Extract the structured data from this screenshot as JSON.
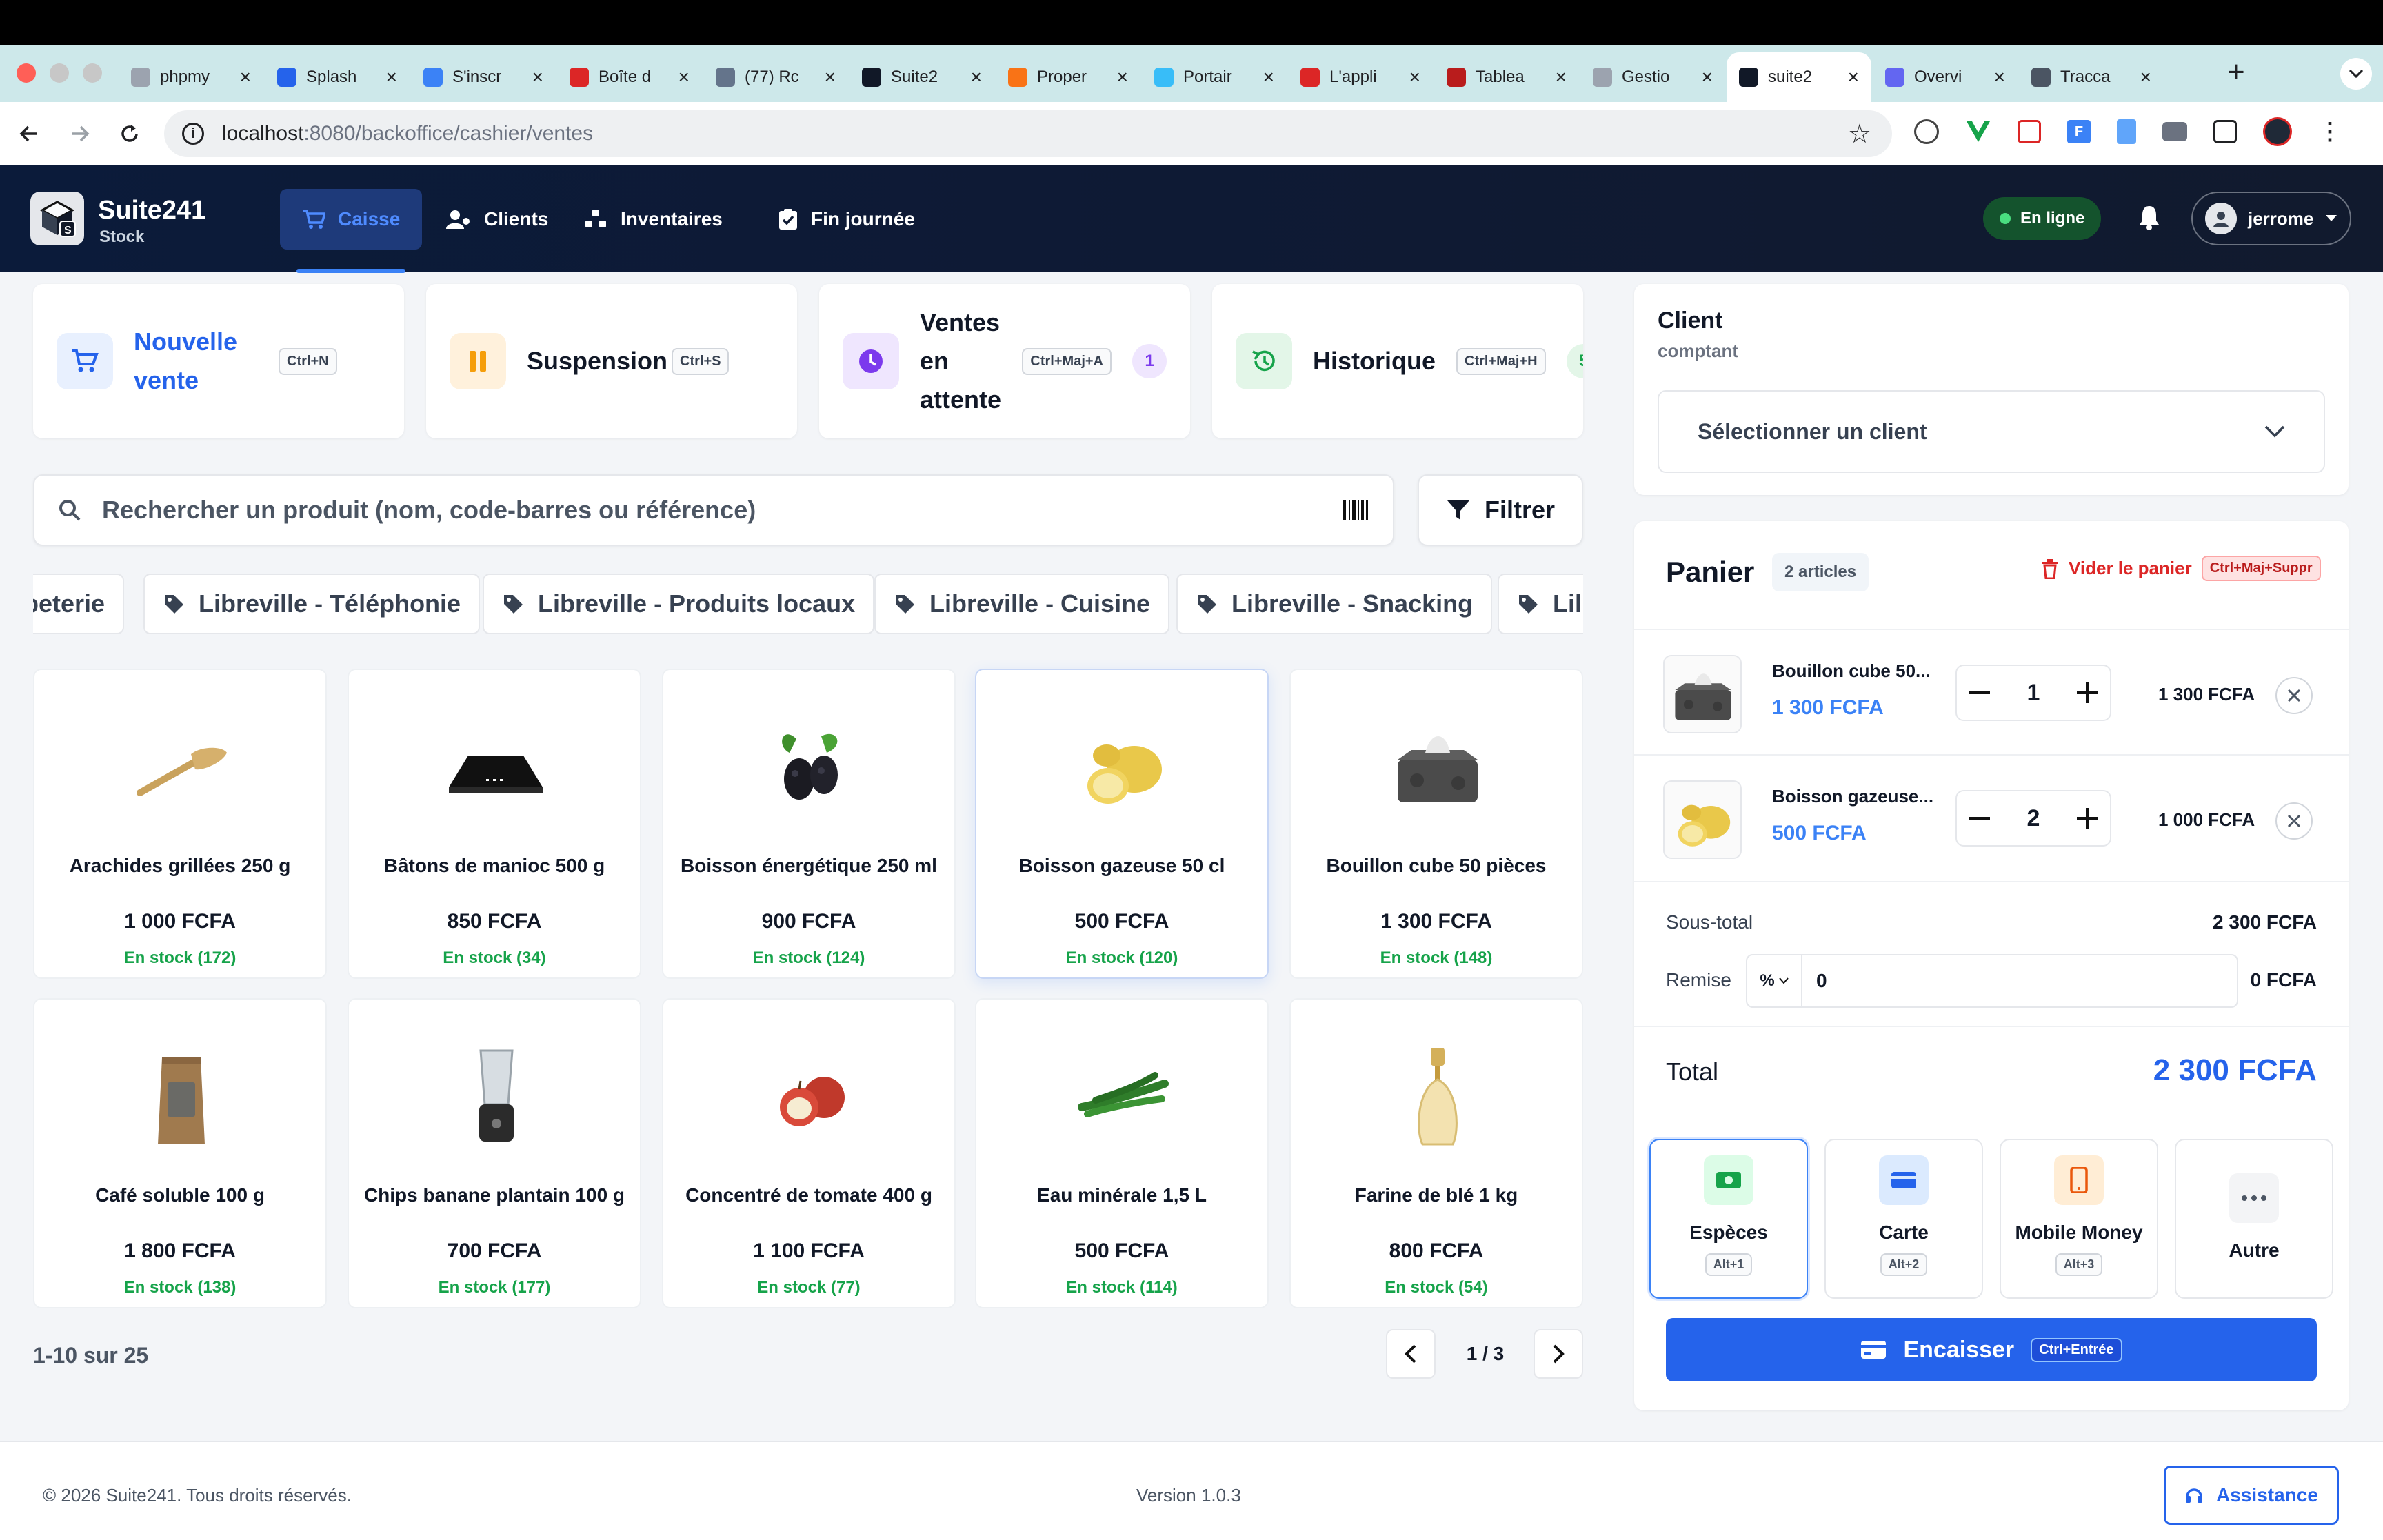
{
  "browser": {
    "tabs": [
      {
        "label": "phpmy",
        "icon": "globe-icon",
        "color": "#9ca3af"
      },
      {
        "label": "Splash",
        "icon": "splash-icon",
        "color": "#2563eb"
      },
      {
        "label": "S'inscr",
        "icon": "apple-icon",
        "color": "#3b82f6"
      },
      {
        "label": "Boîte d",
        "icon": "mail-icon",
        "color": "#dc2626"
      },
      {
        "label": "(77) Rc",
        "icon": "reddit-icon",
        "color": "#64748b"
      },
      {
        "label": "Suite2",
        "icon": "terminal-icon",
        "color": "#111827"
      },
      {
        "label": "Proper",
        "icon": "microsoft-icon",
        "color": "#f97316"
      },
      {
        "label": "Portair",
        "icon": "portainer-icon",
        "color": "#38bdf8"
      },
      {
        "label": "L'appli",
        "icon": "laravel-icon",
        "color": "#dc2626"
      },
      {
        "label": "Tablea",
        "icon": "gmail-icon",
        "color": "#b91c1c"
      },
      {
        "label": "Gestio",
        "icon": "globe-icon",
        "color": "#9ca3af"
      },
      {
        "label": "suite2",
        "icon": "app-icon",
        "color": "#111827"
      },
      {
        "label": "Overvi",
        "icon": "overview-icon",
        "color": "#6366f1"
      },
      {
        "label": "Tracca",
        "icon": "traccar-icon",
        "color": "#4b5563"
      }
    ],
    "url_host": "localhost",
    "url_path": ":8080/backoffice/cashier/ventes"
  },
  "app": {
    "brand": "Suite241",
    "brand_sub": "Stock",
    "nav": [
      {
        "label": "Caisse",
        "icon": "cart-icon"
      },
      {
        "label": "Clients",
        "icon": "users-icon"
      },
      {
        "label": "Inventaires",
        "icon": "inventory-icon"
      },
      {
        "label": "Fin journée",
        "icon": "checklist-icon"
      }
    ],
    "status": "En ligne",
    "user": "jerrome"
  },
  "quick_actions": [
    {
      "label": "Nouvelle vente",
      "kbd": "Ctrl+N",
      "color": "#3b82f6"
    },
    {
      "label": "Suspension",
      "kbd": "Ctrl+S",
      "color": "#f59e0b"
    },
    {
      "label": "Ventes en attente",
      "kbd": "Ctrl+Maj+A",
      "badge": "1",
      "color": "#7c3aed"
    },
    {
      "label": "Historique",
      "kbd": "Ctrl+Maj+H",
      "badge": "5",
      "color": "#16a34a"
    }
  ],
  "search": {
    "placeholder": "Rechercher un produit (nom, code-barres ou référence)",
    "filter_label": "Filtrer"
  },
  "categories": [
    "peterie",
    "Libreville - Téléphonie",
    "Libreville - Produits locaux",
    "Libreville - Cuisine",
    "Libreville - Snacking",
    "Lil"
  ],
  "products": [
    {
      "name": "Arachides grillées 250 g",
      "price": "1 000 FCFA",
      "stock": "En stock (172)",
      "img": "spatula"
    },
    {
      "name": "Bâtons de manioc 500 g",
      "price": "850 FCFA",
      "stock": "En stock (34)",
      "img": "cooktop"
    },
    {
      "name": "Boisson énergétique 250 ml",
      "price": "900 FCFA",
      "stock": "En stock (124)",
      "img": "blackberry"
    },
    {
      "name": "Boisson gazeuse 50 cl",
      "price": "500 FCFA",
      "stock": "En stock (120)",
      "img": "lemon"
    },
    {
      "name": "Bouillon cube 50 pièces",
      "price": "1 300 FCFA",
      "stock": "En stock (148)",
      "img": "tissue"
    },
    {
      "name": "Café soluble 100 g",
      "price": "1 800 FCFA",
      "stock": "En stock (138)",
      "img": "coffee"
    },
    {
      "name": "Chips banane plantain 100 g",
      "price": "700 FCFA",
      "stock": "En stock (177)",
      "img": "blender"
    },
    {
      "name": "Concentré de tomate 400 g",
      "price": "1 100 FCFA",
      "stock": "En stock (77)",
      "img": "apple"
    },
    {
      "name": "Eau minérale 1,5 L",
      "price": "500 FCFA",
      "stock": "En stock (114)",
      "img": "pepper"
    },
    {
      "name": "Farine de blé 1 kg",
      "price": "800 FCFA",
      "stock": "En stock (54)",
      "img": "perfume"
    }
  ],
  "pagination": {
    "range": "1-10 sur 25",
    "page": "1 / 3"
  },
  "client": {
    "title": "Client",
    "subtitle": "comptant",
    "select_placeholder": "Sélectionner un client"
  },
  "cart": {
    "title": "Panier",
    "count": "2 articles",
    "clear_label": "Vider le panier",
    "clear_kbd": "Ctrl+Maj+Suppr",
    "items": [
      {
        "name": "Bouillon cube 50...",
        "unit_price": "1 300 FCFA",
        "qty": "1",
        "total": "1 300 FCFA",
        "img": "tissue"
      },
      {
        "name": "Boisson gazeuse...",
        "unit_price": "500 FCFA",
        "qty": "2",
        "total": "1 000 FCFA",
        "img": "lemon"
      }
    ],
    "subtotal_label": "Sous-total",
    "subtotal": "2 300 FCFA",
    "discount_label": "Remise",
    "discount_type": "%",
    "discount_value": "0",
    "discount_amount": "0 FCFA",
    "total_label": "Total",
    "total": "2 300 FCFA"
  },
  "payment": [
    {
      "label": "Espèces",
      "kbd": "Alt+1",
      "color": "#16a34a",
      "bg": "#dcfce7"
    },
    {
      "label": "Carte",
      "kbd": "Alt+2",
      "color": "#2563eb",
      "bg": "#dbeafe"
    },
    {
      "label": "Mobile Money",
      "kbd": "Alt+3",
      "color": "#ea580c",
      "bg": "#ffedd5"
    },
    {
      "label": "Autre",
      "color": "#4b5563",
      "bg": "#f3f4f6"
    }
  ],
  "checkout": {
    "label": "Encaisser",
    "kbd": "Ctrl+Entrée"
  },
  "footer": {
    "copyright": "© 2026 Suite241. Tous droits réservés.",
    "version": "Version 1.0.3",
    "support": "Assistance"
  }
}
